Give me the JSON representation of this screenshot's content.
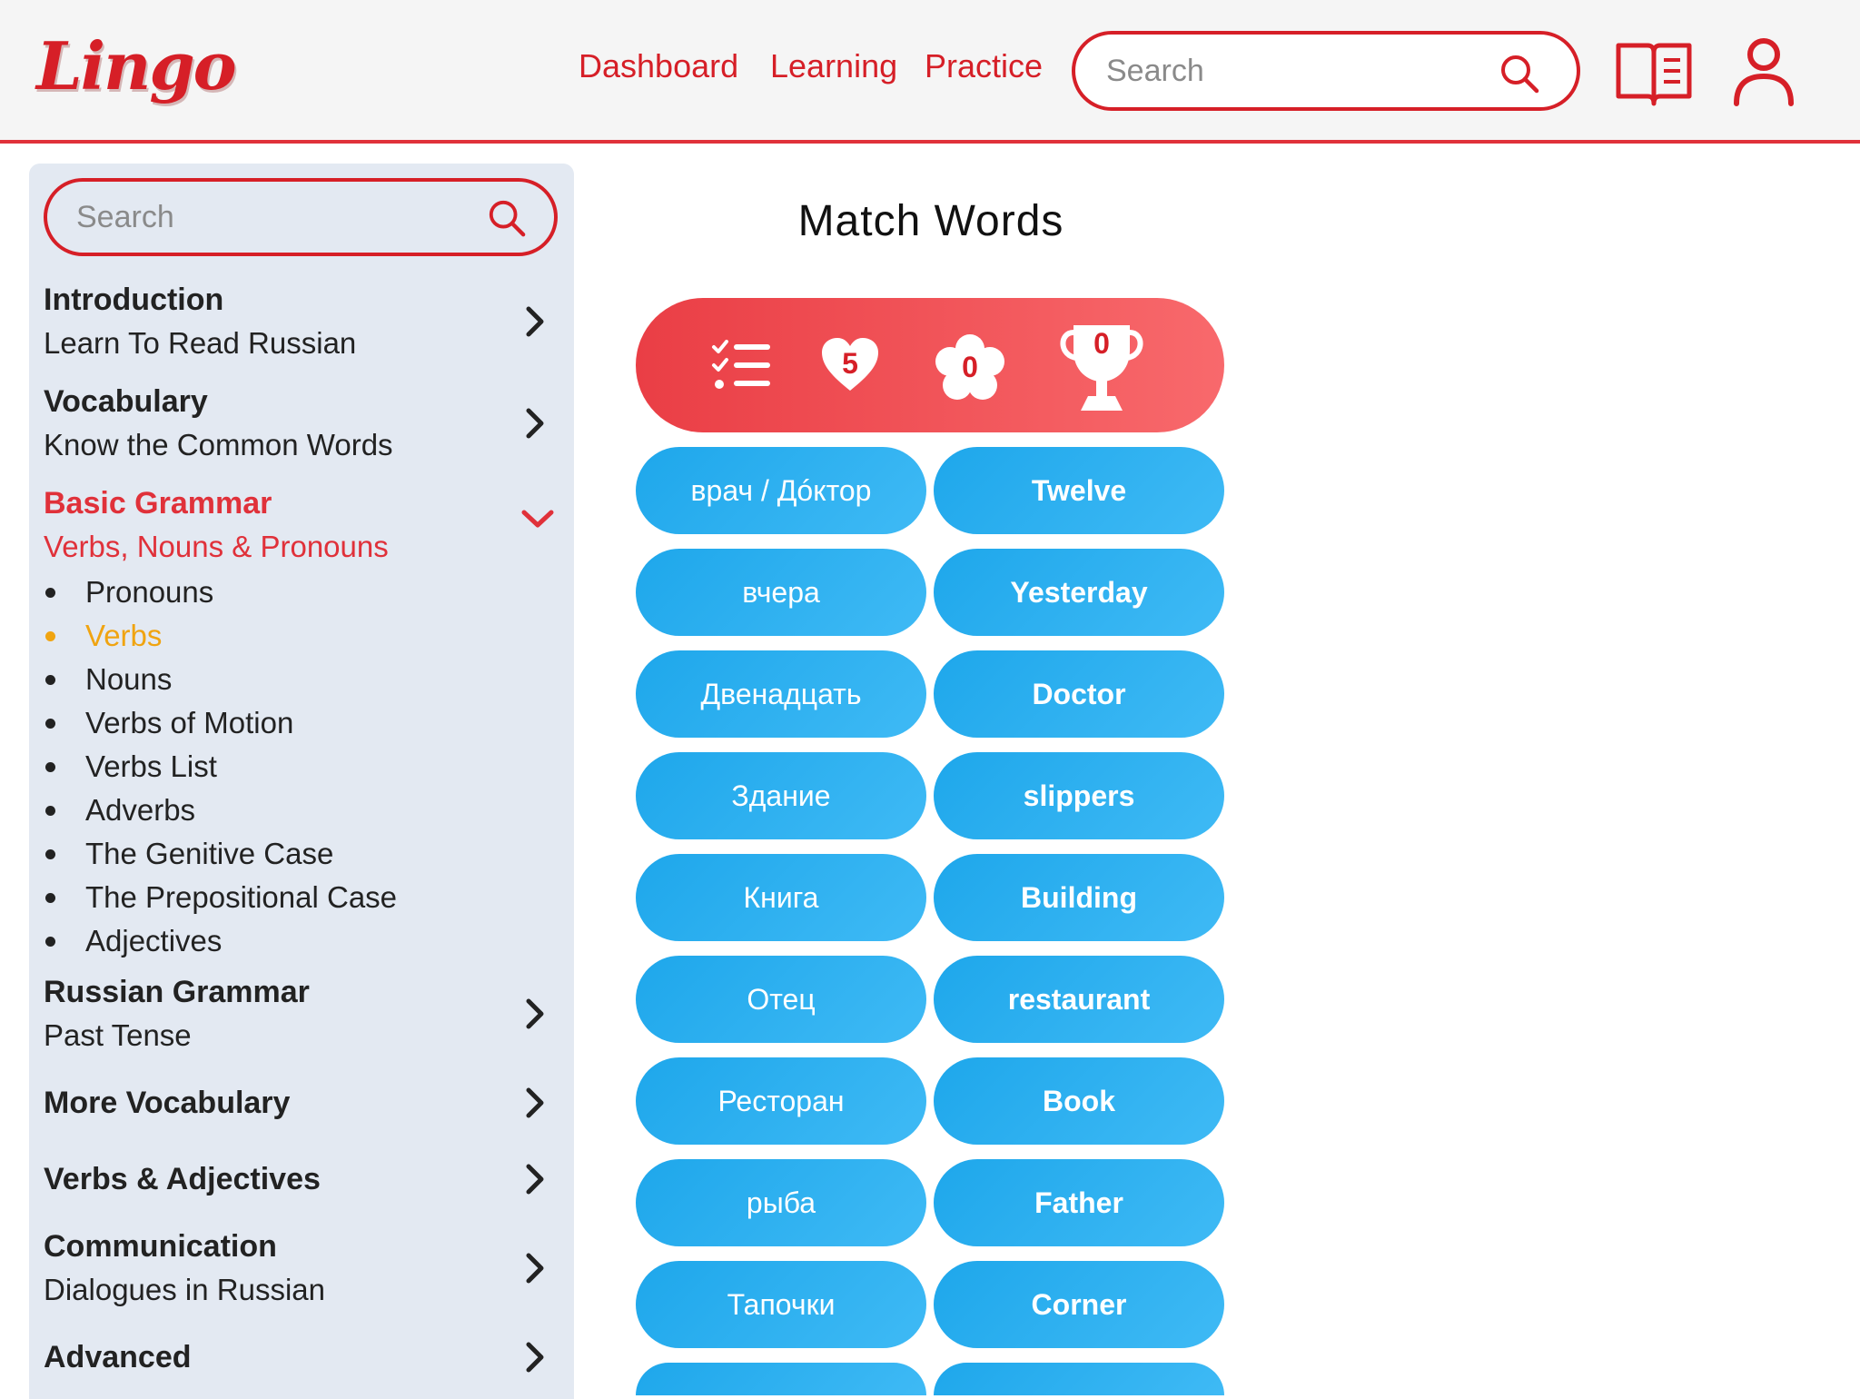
{
  "header": {
    "logo": "Lingo",
    "nav": [
      "Dashboard",
      "Learning",
      "Practice"
    ],
    "search_placeholder": "Search",
    "icons": [
      "search-icon",
      "book-icon",
      "user-icon"
    ],
    "accent_color": "#d61f27"
  },
  "sidebar": {
    "search_placeholder": "Search",
    "sections": [
      {
        "title": "Introduction",
        "subtitle": "Learn To Read Russian",
        "expanded": false
      },
      {
        "title": "Vocabulary",
        "subtitle": "Know the Common Words",
        "expanded": false
      },
      {
        "title": "Basic Grammar",
        "subtitle": "Verbs, Nouns & Pronouns",
        "expanded": true
      },
      {
        "title": "Russian Grammar",
        "subtitle": "Past Tense",
        "expanded": false
      },
      {
        "title": "More Vocabulary",
        "subtitle": "",
        "expanded": false
      },
      {
        "title": "Verbs & Adjectives",
        "subtitle": "",
        "expanded": false
      },
      {
        "title": "Communication",
        "subtitle": "Dialogues in Russian",
        "expanded": false
      },
      {
        "title": "Advanced",
        "subtitle": "",
        "expanded": false
      }
    ],
    "sub_items": [
      "Pronouns",
      "Verbs",
      "Nouns",
      "Verbs of Motion",
      "Verbs List",
      "Adverbs",
      "The Genitive Case",
      "The Prepositional Case",
      "Adjectives"
    ],
    "current_sub_item": "Verbs",
    "active_color": "#e0313a",
    "current_color": "#f0a411"
  },
  "main": {
    "title": "Match Words",
    "stats": {
      "lives": "5",
      "flower_count": "0",
      "trophy_count": "0",
      "icons": [
        "checklist-icon",
        "heart-icon",
        "flower-badge-icon",
        "trophy-icon"
      ]
    },
    "russian_words": [
      "врач / Дóктор",
      "вчера",
      "Двенадцать",
      "Здание",
      "Книга",
      "Отец",
      "Ресторан",
      "рыба",
      "Тапочки"
    ],
    "english_words": [
      "Twelve",
      "Yesterday",
      "Doctor",
      "slippers",
      "Building",
      "restaurant",
      "Book",
      "Father",
      "Corner"
    ],
    "button_color": "#1ea7eb"
  }
}
